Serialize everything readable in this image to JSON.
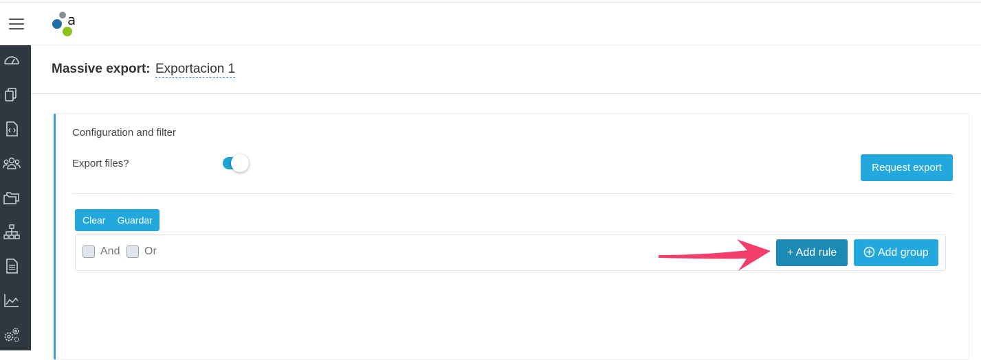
{
  "header": {
    "menu_icon": "hamburger-icon",
    "logo_icon": "app-logo",
    "logo_letter": "a"
  },
  "sidebar": {
    "items": [
      {
        "icon": "dashboard-icon"
      },
      {
        "icon": "documents-icon"
      },
      {
        "icon": "code-file-icon"
      },
      {
        "icon": "users-icon"
      },
      {
        "icon": "folders-icon"
      },
      {
        "icon": "hierarchy-icon"
      },
      {
        "icon": "document-icon"
      },
      {
        "icon": "chart-icon"
      },
      {
        "icon": "settings-icon"
      }
    ]
  },
  "page": {
    "title_label": "Massive export:",
    "title_value": "Exportacion 1"
  },
  "panel": {
    "heading": "Configuration and filter",
    "export_files_label": "Export files?",
    "export_files_enabled": true,
    "request_export_label": "Request export",
    "clear_label": "Clear",
    "guardar_label": "Guardar",
    "and_label": "And",
    "or_label": "Or",
    "add_rule_label": "+ Add rule",
    "add_group_label": "Add group",
    "add_group_icon": "plus-circle-icon"
  },
  "colors": {
    "sidebar_bg": "#2f3740",
    "accent": "#22a8dc",
    "active_button": "#1b8bb6",
    "arrow": "#f33d6b"
  }
}
